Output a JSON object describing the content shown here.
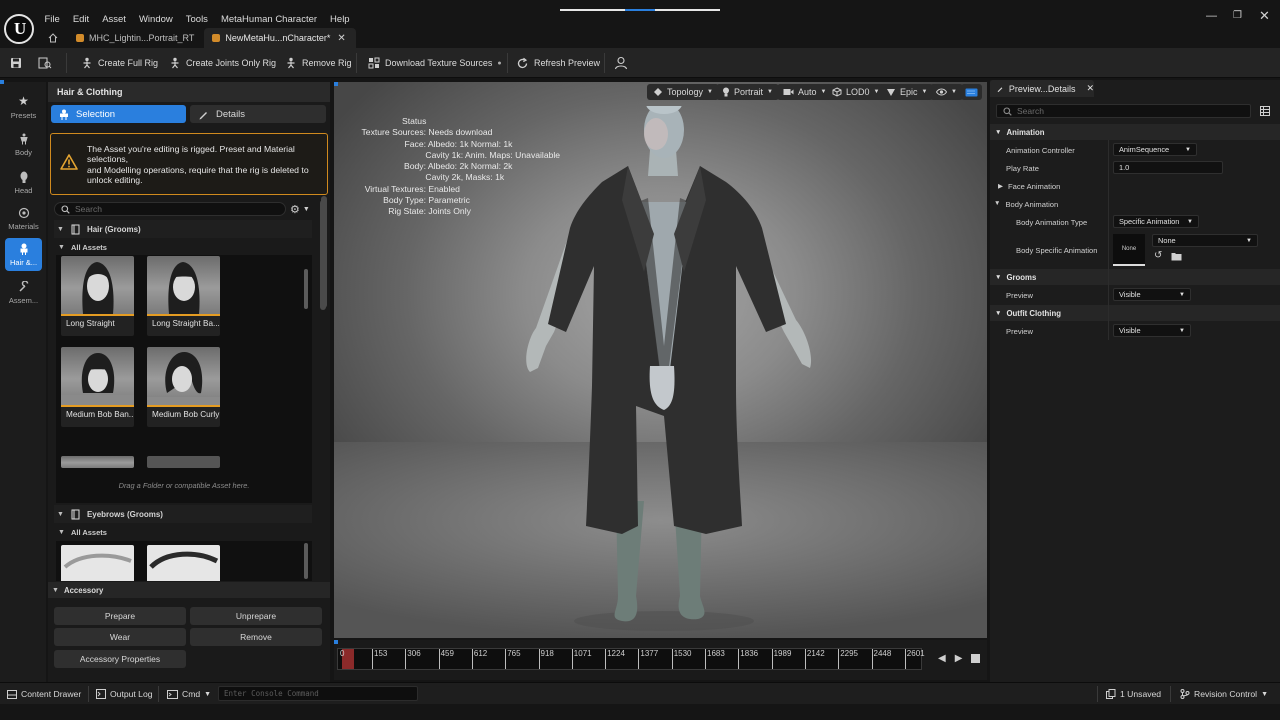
{
  "app": {
    "menu": [
      "File",
      "Edit",
      "Asset",
      "Window",
      "Tools",
      "MetaHuman Character",
      "Help"
    ],
    "tabs": [
      {
        "label": "MHC_Lightin...Portrait_RT",
        "active": false
      },
      {
        "label": "NewMetaHu...nCharacter*",
        "active": true
      }
    ]
  },
  "toolbar": {
    "create_full_rig": "Create Full Rig",
    "create_joints_only_rig": "Create Joints Only Rig",
    "remove_rig": "Remove Rig",
    "download_texture_sources": "Download Texture Sources",
    "refresh_preview": "Refresh Preview"
  },
  "modes": [
    {
      "label": "Presets",
      "icon": "star-icon",
      "active": false
    },
    {
      "label": "Body",
      "icon": "body-icon",
      "active": false
    },
    {
      "label": "Head",
      "icon": "head-icon",
      "active": false
    },
    {
      "label": "Materials",
      "icon": "materials-icon",
      "active": false
    },
    {
      "label": "Hair &...",
      "icon": "hair-icon",
      "active": true
    },
    {
      "label": "Assem...",
      "icon": "wrench-icon",
      "active": false
    }
  ],
  "left_panel": {
    "title": "Hair & Clothing",
    "selection_tab": "Selection",
    "details_tab": "Details",
    "warning": "The Asset you're editing is rigged. Preset and Material selections,\nand Modelling operations, require that the rig is deleted to unlock editing.",
    "search_placeholder": "Search",
    "hair_section": "Hair (Grooms)",
    "all_assets": "All Assets",
    "hair_items": [
      "Long Straight",
      "Long Straight Ba...",
      "Medium Bob Ban...",
      "Medium Bob Curly"
    ],
    "drop_hint": "Drag a Folder or compatible Asset here.",
    "eyebrows_section": "Eyebrows (Grooms)",
    "eyebrows_all_assets": "All Assets",
    "accessory": {
      "title": "Accessory",
      "prepare": "Prepare",
      "unprepare": "Unprepare",
      "wear": "Wear",
      "remove": "Remove",
      "properties": "Accessory Properties"
    }
  },
  "viewport": {
    "toolbar": {
      "topology": "Topology",
      "portrait": "Portrait",
      "auto": "Auto",
      "lod": "LOD0",
      "quality": "Epic"
    },
    "status": {
      "title": "Status",
      "rows": [
        {
          "key": "Texture Sources:",
          "value": "Needs download"
        },
        {
          "key": "Face:",
          "value": "Albedo: 1k Normal: 1k"
        },
        {
          "key": "",
          "value": "Cavity 1k: Anim. Maps: Unavailable"
        },
        {
          "key": "Body:",
          "value": "Albedo: 2k Normal: 2k"
        },
        {
          "key": "",
          "value": "Cavity 2k, Masks: 1k"
        },
        {
          "key": "Virtual Textures:",
          "value": "Enabled"
        },
        {
          "key": "Body Type:",
          "value": "Parametric"
        },
        {
          "key": "Rig State:",
          "value": "Joints Only"
        }
      ]
    }
  },
  "timeline": {
    "current": "0",
    "ticks": [
      "153",
      "306",
      "459",
      "612",
      "765",
      "918",
      "1071",
      "1224",
      "1377",
      "1530",
      "1683",
      "1836",
      "1989",
      "2142",
      "2295",
      "2448",
      "2601"
    ]
  },
  "details": {
    "tab_label": "Preview...Details",
    "search_placeholder": "Search",
    "animation": "Animation",
    "animation_controller_label": "Animation Controller",
    "animation_controller_value": "AnimSequence",
    "play_rate_label": "Play Rate",
    "play_rate_value": "1.0",
    "face_animation": "Face Animation",
    "body_animation": "Body Animation",
    "body_animation_type_label": "Body Animation Type",
    "body_animation_type_value": "Specific Animation",
    "body_specific_animation_label": "Body Specific Animation",
    "body_specific_thumb": "None",
    "body_specific_value": "None",
    "grooms": "Grooms",
    "grooms_preview_label": "Preview",
    "grooms_preview_value": "Visible",
    "outfit_clothing": "Outfit Clothing",
    "outfit_preview_label": "Preview",
    "outfit_preview_value": "Visible"
  },
  "statusbar": {
    "content_drawer": "Content Drawer",
    "output_log": "Output Log",
    "cmd": "Cmd",
    "console_placeholder": "Enter Console Command",
    "unsaved": "1 Unsaved",
    "revision_control": "Revision Control"
  },
  "colors": {
    "accent": "#2a7fde",
    "warning": "#d08a1e",
    "thumb_underline": "#e59c22"
  }
}
